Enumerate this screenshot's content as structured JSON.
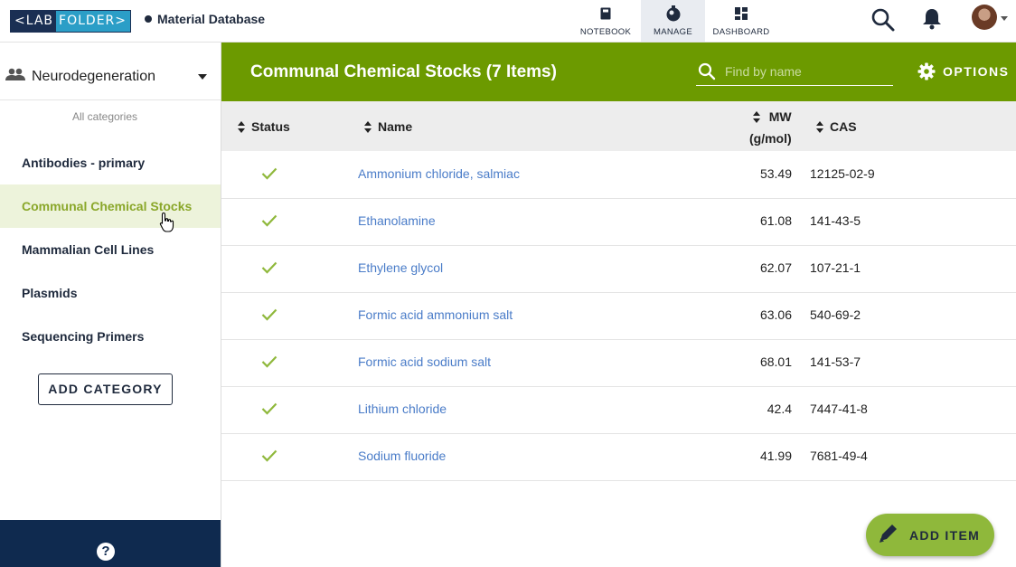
{
  "header": {
    "logo_left": "<LAB",
    "logo_right": "FOLDER>",
    "db_title": "Material Database",
    "tabs": [
      {
        "label": "NOTEBOOK",
        "icon": "notebook-icon"
      },
      {
        "label": "MANAGE",
        "icon": "manage-icon",
        "active": true
      },
      {
        "label": "DASHBOARD",
        "icon": "dashboard-icon"
      }
    ]
  },
  "sidebar": {
    "group_name": "Neurodegeneration",
    "all_categories": "All categories",
    "categories": [
      {
        "label": "Antibodies - primary"
      },
      {
        "label": "Communal Chemical Stocks",
        "active": true
      },
      {
        "label": "Mammalian Cell Lines"
      },
      {
        "label": "Plasmids"
      },
      {
        "label": "Sequencing Primers"
      }
    ],
    "add_category": "ADD CATEGORY",
    "help": "?"
  },
  "main": {
    "title": "Communal Chemical Stocks (7 Items)",
    "search_placeholder": "Find by name",
    "options_label": "OPTIONS",
    "columns": {
      "status": "Status",
      "name": "Name",
      "mw_line1": "MW",
      "mw_line2": "(g/mol)",
      "cas": "CAS"
    },
    "rows": [
      {
        "name": "Ammonium chloride, salmiac",
        "mw": "53.49",
        "cas": "12125-02-9"
      },
      {
        "name": "Ethanolamine",
        "mw": "61.08",
        "cas": "141-43-5"
      },
      {
        "name": "Ethylene glycol",
        "mw": "62.07",
        "cas": "107-21-1"
      },
      {
        "name": "Formic acid ammonium salt",
        "mw": "63.06",
        "cas": "540-69-2"
      },
      {
        "name": "Formic acid sodium salt",
        "mw": "68.01",
        "cas": "141-53-7"
      },
      {
        "name": "Lithium chloride",
        "mw": "42.4",
        "cas": "7447-41-8"
      },
      {
        "name": "Sodium fluoride",
        "mw": "41.99",
        "cas": "7681-49-4"
      }
    ],
    "add_item": "ADD ITEM"
  },
  "colors": {
    "accent_green": "#6c9a00",
    "navy": "#0f2a4f",
    "link_blue": "#4a7cc8",
    "check_green": "#8fb83b"
  }
}
